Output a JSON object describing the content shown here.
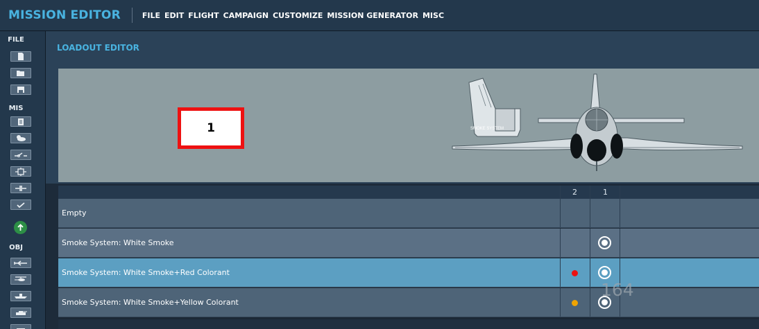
{
  "window": {
    "app_title": "MISSION EDITOR"
  },
  "menu": {
    "items": [
      "FILE",
      "EDIT",
      "FLIGHT",
      "CAMPAIGN",
      "CUSTOMIZE",
      "MISSION GENERATOR",
      "MISC"
    ]
  },
  "toolbar": {
    "file_label": "FILE",
    "mis_label": "MIS",
    "obj_label": "OBJ",
    "file_buttons": [
      "new-file-icon",
      "open-folder-icon",
      "save-icon"
    ],
    "mis_buttons": [
      "briefing-icon",
      "weather-icon",
      "triggers-icon",
      "map-options-icon",
      "resources-icon",
      "check-icon"
    ],
    "obj_buttons": [
      "aircraft-icon",
      "helicopter-icon",
      "ship-icon",
      "vehicle-icon"
    ]
  },
  "editor": {
    "title": "LOADOUT EDITOR"
  },
  "preview": {
    "aircraft_label": "SMOKE SYSTEM",
    "callout": "1"
  },
  "table": {
    "station_headers": [
      "2",
      "1"
    ],
    "rows": [
      {
        "label": "Empty"
      },
      {
        "label": "Smoke System: White Smoke"
      },
      {
        "label": "Smoke System: White Smoke+Red Colorant"
      },
      {
        "label": "Smoke System: White Smoke+Yellow Colorant"
      }
    ]
  },
  "page_number": "164",
  "colors": {
    "accent": "#49b3e0",
    "selected_row": "#5c9fc2",
    "red_colorant": "#ee1111",
    "yellow_colorant": "#f0a400",
    "callout_border": "#ee1111"
  }
}
